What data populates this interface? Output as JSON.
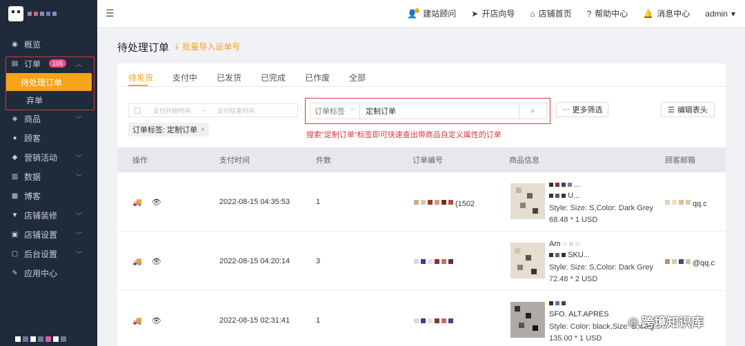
{
  "topbar": {
    "links": [
      {
        "icon": "person-icon",
        "label": "建站顾问"
      },
      {
        "icon": "send-icon",
        "label": "开店向导"
      },
      {
        "icon": "home-icon",
        "label": "店铺首页"
      },
      {
        "icon": "help-icon",
        "label": "帮助中心"
      },
      {
        "icon": "bell-icon",
        "label": "消息中心"
      }
    ],
    "user": "admin"
  },
  "sidebar": {
    "items": [
      {
        "label": "概览",
        "icon": "dashboard-icon"
      },
      {
        "label": "订单",
        "icon": "order-icon",
        "badge": "105"
      },
      {
        "label": "待处理订单",
        "sub": true,
        "active": true
      },
      {
        "label": "弃单",
        "sub": true
      },
      {
        "label": "商品",
        "icon": "product-icon"
      },
      {
        "label": "顾客",
        "icon": "customer-icon"
      },
      {
        "label": "营销活动",
        "icon": "marketing-icon"
      },
      {
        "label": "数据",
        "icon": "chart-icon"
      },
      {
        "label": "博客",
        "icon": "blog-icon"
      },
      {
        "label": "店铺装修",
        "icon": "paint-icon"
      },
      {
        "label": "店铺设置",
        "icon": "settings-icon"
      },
      {
        "label": "后台设置",
        "icon": "admin-icon"
      },
      {
        "label": "应用中心",
        "icon": "apps-icon"
      }
    ]
  },
  "page": {
    "title": "待处理订单",
    "import_label": "批量导入运单号"
  },
  "tabs": [
    "待发货",
    "支付中",
    "已发货",
    "已完成",
    "已作废",
    "全部"
  ],
  "filters": {
    "date_start_placeholder": "支付开始时间",
    "date_sep": "-",
    "date_end_placeholder": "支付结束时间",
    "chip_label": "订单标签: 定制订单",
    "search_select": "订单标签",
    "search_value": "定制订单",
    "hint": "搜索\"定制订单\"标签即可快速查出带商品自定义属性的订单",
    "more_filters": "更多筛选",
    "edit_header": "编辑表头"
  },
  "table": {
    "headers": [
      "操作",
      "支付时间",
      "件数",
      "订单编号",
      "商品信息",
      "顾客邮箱"
    ],
    "rows": [
      {
        "time": "2022-08-15 04:35:53",
        "qty": "1",
        "order_suffix": "(1502",
        "prod_title": "...",
        "prod_title2": "U...",
        "style": "Style: Size: S,Color: Dark Grey",
        "price": "68.48 * 1 USD",
        "email_suffix": "qq.c"
      },
      {
        "time": "2022-08-15 04:20:14",
        "qty": "3",
        "order_suffix": "",
        "prod_title": "Am",
        "prod_title2": "SKU...",
        "style": "Style: Size: S,Color: Dark Grey",
        "price": "72.48 * 2 USD",
        "email_suffix": "@qq.c"
      },
      {
        "time": "2022-08-15 02:31:41",
        "qty": "1",
        "order_suffix": "",
        "prod_title": "SFO. ALT.APRES",
        "prod_title2": "",
        "style": "Style: Color: black,Size: S,weig...",
        "price": "135.00 * 1 USD",
        "email_suffix": ""
      }
    ]
  },
  "watermark": "跨境知识库"
}
